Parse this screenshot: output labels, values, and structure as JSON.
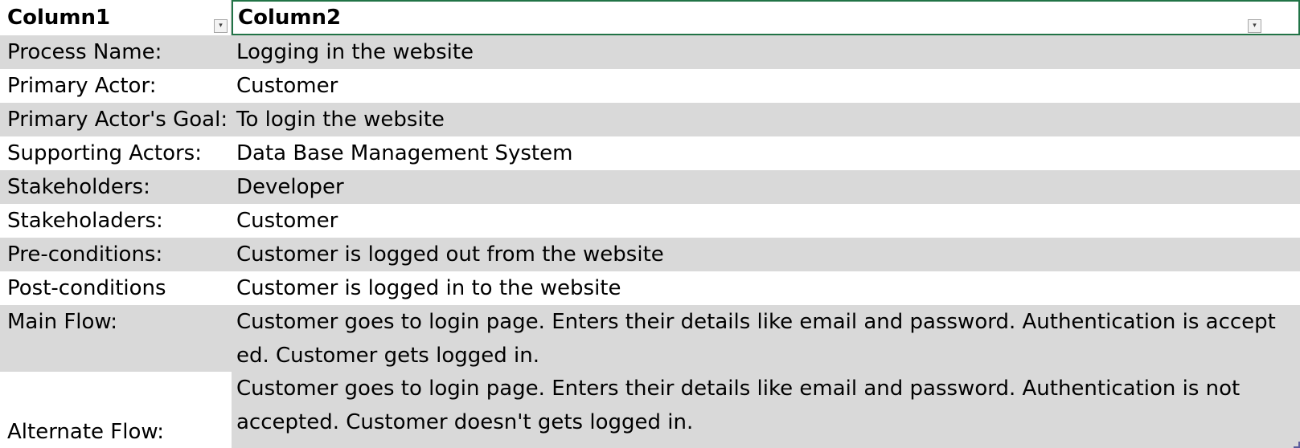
{
  "table": {
    "headers": [
      "Column1",
      "Column2"
    ],
    "filter_glyph": "▾",
    "rows": [
      {
        "label": "Process Name:",
        "value": "Logging in the website"
      },
      {
        "label": "Primary Actor:",
        "value": "Customer"
      },
      {
        "label": "Primary Actor's Goal:",
        "value": "To login the website"
      },
      {
        "label": "Supporting Actors:",
        "value": "Data Base Management System"
      },
      {
        "label": "Stakeholders:",
        "value": "Developer"
      },
      {
        "label": "Stakeholaders:",
        "value": "Customer"
      },
      {
        "label": "Pre-conditions:",
        "value": "Customer is logged out from the website"
      },
      {
        "label": "Post-conditions",
        "value": "Customer is logged in to the website"
      },
      {
        "label": "Main Flow:",
        "value_lines": [
          "Customer goes to login page. Enters their details like email and password. Authentication is accept",
          "ed. Customer gets logged in."
        ]
      },
      {
        "label": "Alternate Flow:",
        "value_lines": [
          "Customer goes to login page. Enters their details like email and password. Authentication is not",
          "accepted. Customer doesn't gets logged in."
        ]
      }
    ]
  },
  "colors": {
    "band": "#d9d9d9",
    "selection": "#217346"
  }
}
